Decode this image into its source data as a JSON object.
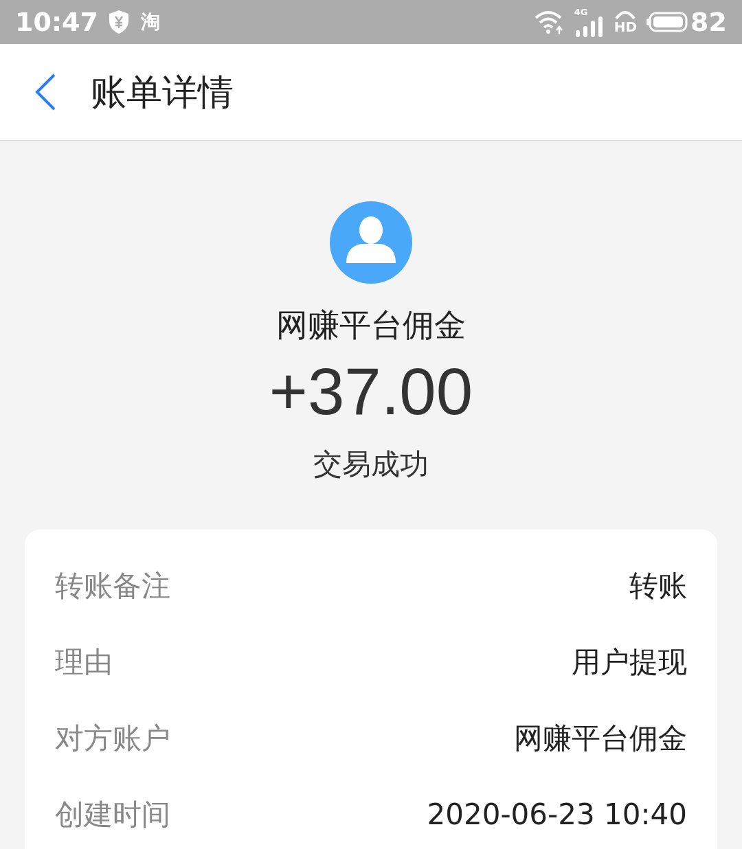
{
  "status_bar": {
    "time": "10:47",
    "notification_badge": "淘",
    "network": "4G",
    "call_mode": "HD",
    "battery": "82"
  },
  "header": {
    "title": "账单详情"
  },
  "summary": {
    "name": "网赚平台佣金",
    "amount": "+37.00",
    "status": "交易成功"
  },
  "details": [
    {
      "label": "转账备注",
      "value": "转账"
    },
    {
      "label": "理由",
      "value": "用户提现"
    },
    {
      "label": "对方账户",
      "value": "网赚平台佣金"
    },
    {
      "label": "创建时间",
      "value": "2020-06-23 10:40"
    }
  ]
}
